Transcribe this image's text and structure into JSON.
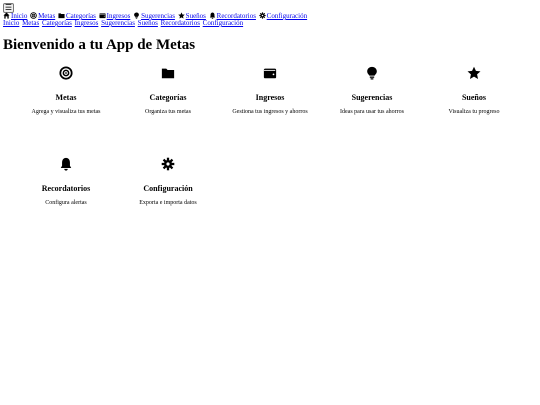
{
  "menu_toggle": {
    "icon": "hamburger-icon",
    "label": "☰"
  },
  "nav_icons": [
    {
      "label": "Inicio",
      "icon": "home-icon"
    },
    {
      "label": "Metas",
      "icon": "target-icon"
    },
    {
      "label": "Categorías",
      "icon": "folder-icon"
    },
    {
      "label": "Ingresos",
      "icon": "wallet-icon"
    },
    {
      "label": "Sugerencias",
      "icon": "lightbulb-icon"
    },
    {
      "label": "Sueños",
      "icon": "star-icon"
    },
    {
      "label": "Recordatorios",
      "icon": "bell-icon"
    },
    {
      "label": "Configuración",
      "icon": "gear-icon"
    }
  ],
  "nav_text": [
    "Inicio",
    "Metas",
    "Categorías",
    "Ingresos",
    "Sugerencias",
    "Sueños",
    "Recordatorios",
    "Configuración"
  ],
  "page_title": "Bienvenido a tu App de Metas",
  "cards": [
    {
      "title": "Metas",
      "desc": "Agrega y visualiza tus metas",
      "icon": "target-icon"
    },
    {
      "title": "Categorías",
      "desc": "Organiza tus metas",
      "icon": "folder-icon"
    },
    {
      "title": "Ingresos",
      "desc": "Gestiona tus ingresos y ahorros",
      "icon": "wallet-icon"
    },
    {
      "title": "Sugerencias",
      "desc": "Ideas para usar tus ahorros",
      "icon": "lightbulb-icon"
    },
    {
      "title": "Sueños",
      "desc": "Visualiza tu progreso",
      "icon": "star-icon"
    },
    {
      "title": "Recordatorios",
      "desc": "Configura alertas",
      "icon": "bell-icon"
    },
    {
      "title": "Configuración",
      "desc": "Exporta e importa datos",
      "icon": "gear-icon"
    }
  ]
}
